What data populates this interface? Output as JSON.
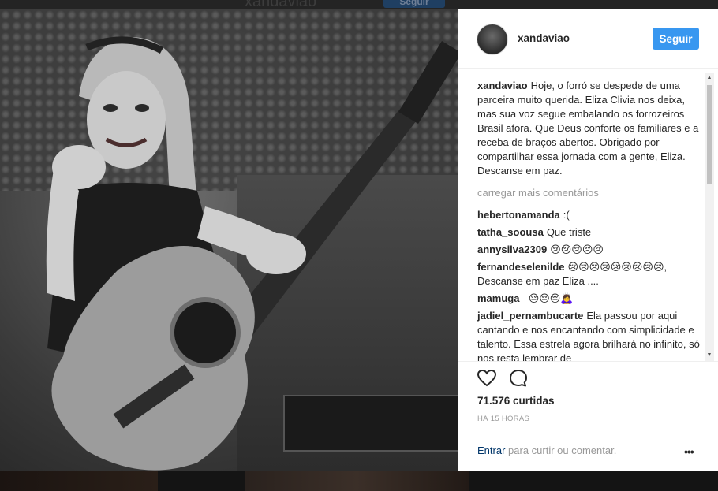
{
  "background": {
    "username": "xandaviao",
    "follow_label": "Seguir"
  },
  "post": {
    "username": "xandaviao",
    "follow_label": "Seguir",
    "caption": {
      "author": "xandaviao",
      "text": "Hoje, o forró se despede de uma parceira muito querida. Eliza Clivia nos deixa, mas sua voz segue embalando os forrozeiros Brasil afora. Que Deus conforte os familiares e a receba de braços abertos. Obrigado por compartilhar essa jornada com a gente, Eliza. Descanse em paz."
    },
    "load_more": "carregar mais comentários",
    "comments": [
      {
        "author": "hebertonamanda",
        "text": ":("
      },
      {
        "author": "tatha_soousa",
        "text": "Que triste"
      },
      {
        "author": "annysilva2309",
        "text": "😢😢😢😢😢"
      },
      {
        "author": "fernandeselenilde",
        "text": "😢😢😢😢😢😢😢😢😢, Descanse em paz Eliza ...."
      },
      {
        "author": "mamuga_",
        "text": "😔😔😔🙇‍♀️"
      },
      {
        "author": "jadiel_pernambucarte",
        "text": "Ela passou por aqui cantando e nos encantando com simplicidade e talento. Essa estrela agora brilhará no infinito, só nos resta lembrar de"
      }
    ],
    "likes": "71.576 curtidas",
    "timestamp": "HÁ 15 HORAS",
    "login_link": "Entrar",
    "login_text": "para curtir ou comentar.",
    "more_label": "•••",
    "icons": {
      "like": "heart-icon",
      "comment": "comment-bubble-icon",
      "more": "more-options-icon"
    }
  },
  "colors": {
    "accent": "#3897f0",
    "text": "#262626",
    "muted": "#999999",
    "link": "#003569"
  }
}
